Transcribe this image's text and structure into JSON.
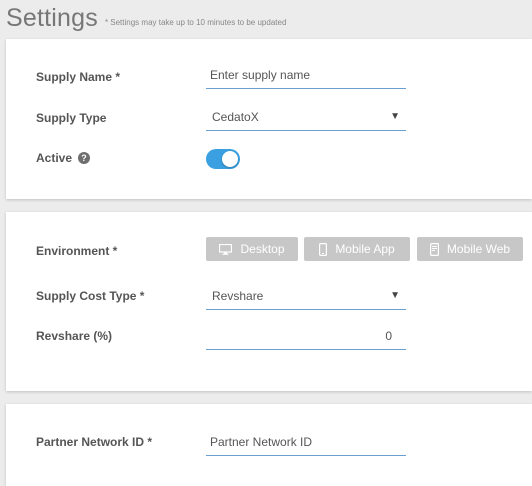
{
  "header": {
    "title": "Settings",
    "note": "* Settings may take up to 10 minutes to be updated"
  },
  "general": {
    "supply_name": {
      "label": "Supply Name *",
      "placeholder": "Enter supply name",
      "value": ""
    },
    "supply_type": {
      "label": "Supply Type",
      "value": "CedatoX"
    },
    "active": {
      "label": "Active",
      "help": "?",
      "on": true
    }
  },
  "environment": {
    "label": "Environment *",
    "options": [
      {
        "label": "Desktop",
        "icon": "monitor-icon"
      },
      {
        "label": "Mobile App",
        "icon": "phone-icon"
      },
      {
        "label": "Mobile Web",
        "icon": "mobile-web-icon"
      }
    ],
    "supply_cost_type": {
      "label": "Supply Cost Type *",
      "value": "Revshare"
    },
    "revshare": {
      "label": "Revshare (%)",
      "value": "0"
    }
  },
  "partner": {
    "label": "Partner Network ID *",
    "placeholder": "Partner Network ID",
    "value": ""
  },
  "colors": {
    "accent": "#3aa0e2",
    "underline": "#6b9fcf",
    "env_button_bg": "#c7c7c7",
    "page_bg": "#ececec"
  }
}
